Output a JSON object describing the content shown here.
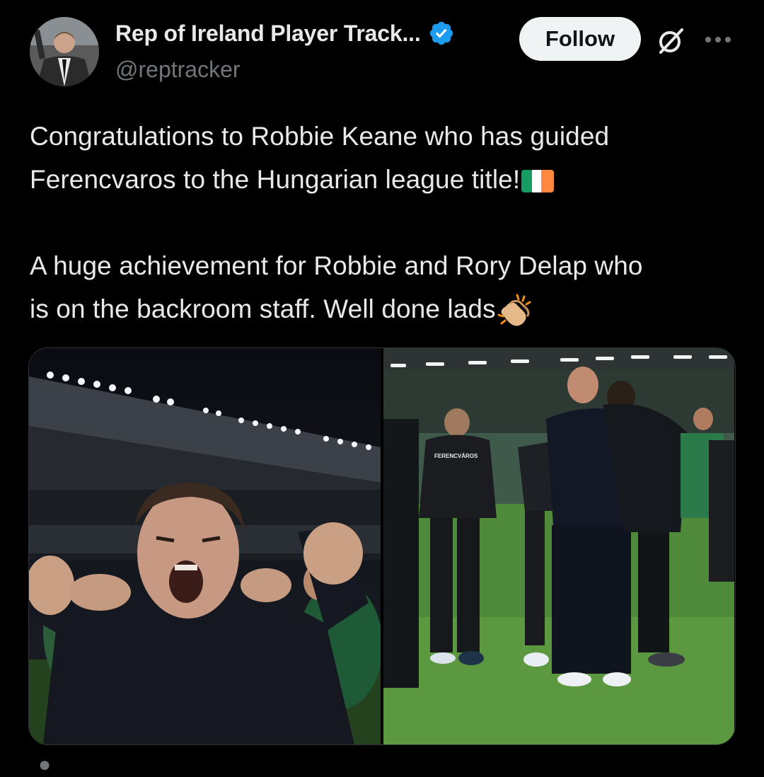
{
  "author": {
    "display_name": "Rep of Ireland Player Track...",
    "handle": "@reptracker",
    "avatar_icon": "avatar-photo",
    "verified_icon": "verified-badge-icon",
    "verified_color": "#1d9bf0"
  },
  "actions": {
    "follow_label": "Follow",
    "grok_icon": "grok-icon",
    "more_icon": "more-icon"
  },
  "tweet": {
    "line1": "Congratulations to Robbie Keane who has guided",
    "line2": "Ferencvaros to the Hungarian league title!",
    "line3": "A huge achievement for Robbie and Rory Delap who",
    "line4": "is on the backroom staff. Well done lads",
    "emoji_1": "ireland-flag-emoji",
    "emoji_2": "clapping-hands-emoji"
  },
  "media": {
    "photo_1_jersey_text": "FERENCVÁROS",
    "photo_count": 2
  },
  "colors": {
    "background": "#000000",
    "text_primary": "#e7e9ea",
    "text_secondary": "#71767b",
    "follow_bg": "#eff3f4"
  }
}
